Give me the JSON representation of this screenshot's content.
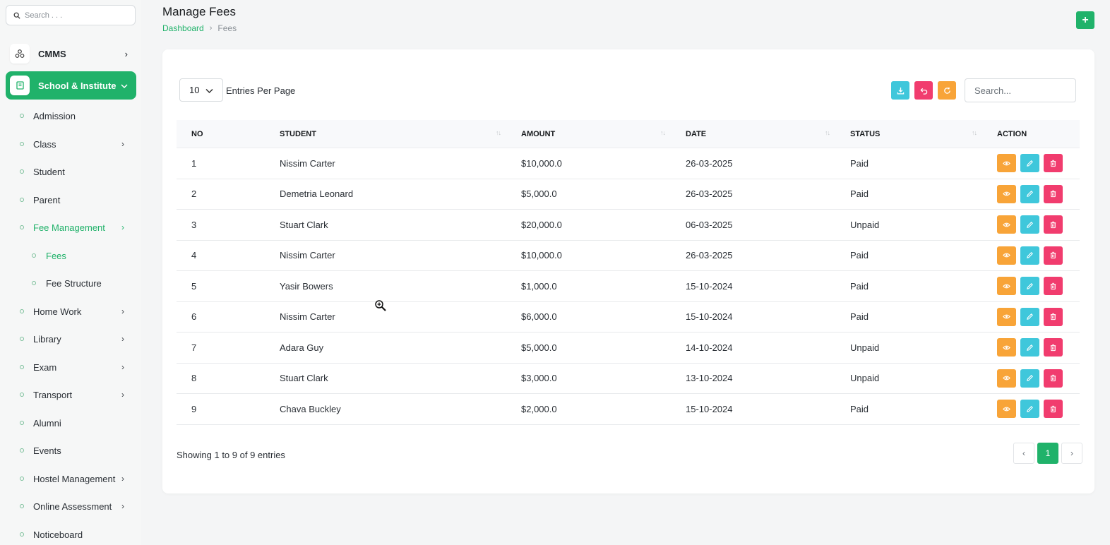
{
  "sidebar": {
    "search_placeholder": "Search . . .",
    "modules": [
      {
        "label": "CMMS",
        "icon": "nodes-icon",
        "chevron": "›"
      },
      {
        "label": "School & Institute",
        "icon": "book-icon",
        "chevron": "⌄"
      }
    ],
    "items": [
      {
        "label": "Admission",
        "chevron": ""
      },
      {
        "label": "Class",
        "chevron": "›"
      },
      {
        "label": "Student",
        "chevron": ""
      },
      {
        "label": "Parent",
        "chevron": ""
      },
      {
        "label": "Fee Management",
        "chevron": "›"
      },
      {
        "label": "Fees",
        "chevron": ""
      },
      {
        "label": "Fee Structure",
        "chevron": ""
      },
      {
        "label": "Home Work",
        "chevron": "›"
      },
      {
        "label": "Library",
        "chevron": "›"
      },
      {
        "label": "Exam",
        "chevron": "›"
      },
      {
        "label": "Transport",
        "chevron": "›"
      },
      {
        "label": "Alumni",
        "chevron": ""
      },
      {
        "label": "Events",
        "chevron": ""
      },
      {
        "label": "Hostel Management",
        "chevron": "›"
      },
      {
        "label": "Online Assessment",
        "chevron": "›"
      },
      {
        "label": "Noticeboard",
        "chevron": ""
      }
    ]
  },
  "header": {
    "title": "Manage Fees",
    "breadcrumb": {
      "link": "Dashboard",
      "separator": "›",
      "current": "Fees"
    },
    "add_label": "+"
  },
  "controls": {
    "entries_value": "10",
    "entries_label": "Entries Per Page",
    "search_placeholder": "Search..."
  },
  "table": {
    "columns": [
      "NO",
      "STUDENT",
      "AMOUNT",
      "DATE",
      "STATUS",
      "ACTION"
    ],
    "sort_glyph": "↑↓",
    "rows": [
      {
        "no": "1",
        "student": "Nissim Carter",
        "amount": "$10,000.0",
        "date": "26-03-2025",
        "status": "Paid"
      },
      {
        "no": "2",
        "student": "Demetria Leonard",
        "amount": "$5,000.0",
        "date": "26-03-2025",
        "status": "Paid"
      },
      {
        "no": "3",
        "student": "Stuart Clark",
        "amount": "$20,000.0",
        "date": "06-03-2025",
        "status": "Unpaid"
      },
      {
        "no": "4",
        "student": "Nissim Carter",
        "amount": "$10,000.0",
        "date": "26-03-2025",
        "status": "Paid"
      },
      {
        "no": "5",
        "student": "Yasir Bowers",
        "amount": "$1,000.0",
        "date": "15-10-2024",
        "status": "Paid"
      },
      {
        "no": "6",
        "student": "Nissim Carter",
        "amount": "$6,000.0",
        "date": "15-10-2024",
        "status": "Paid"
      },
      {
        "no": "7",
        "student": "Adara Guy",
        "amount": "$5,000.0",
        "date": "14-10-2024",
        "status": "Unpaid"
      },
      {
        "no": "8",
        "student": "Stuart Clark",
        "amount": "$3,000.0",
        "date": "13-10-2024",
        "status": "Unpaid"
      },
      {
        "no": "9",
        "student": "Chava Buckley",
        "amount": "$2,000.0",
        "date": "15-10-2024",
        "status": "Paid"
      }
    ]
  },
  "footer": {
    "info": "Showing 1 to 9 of 9 entries",
    "prev": "‹",
    "page": "1",
    "next": "›"
  },
  "colors": {
    "brand": "#20b26a",
    "view": "#f8a438",
    "edit": "#3fc7db",
    "delete": "#f13c6e"
  }
}
